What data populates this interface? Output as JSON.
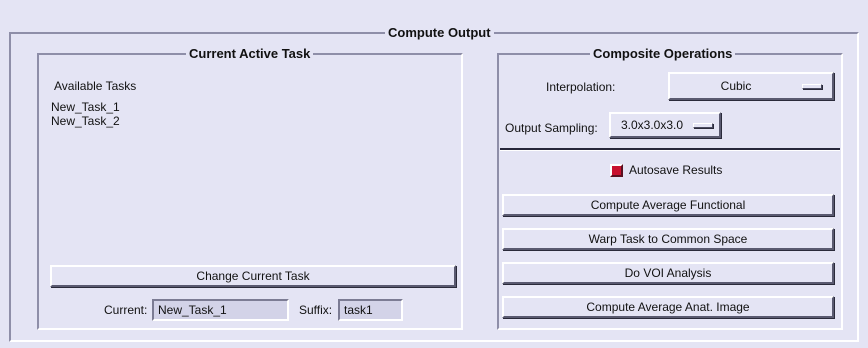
{
  "main": {
    "title": "Compute Output"
  },
  "active_task": {
    "title": "Current Active Task",
    "list_header": "Available Tasks",
    "tasks": [
      "New_Task_1",
      "New_Task_2"
    ],
    "change_button": "Change Current Task",
    "current_label": "Current:",
    "current_value": "New_Task_1",
    "suffix_label": "Suffix:",
    "suffix_value": "task1"
  },
  "composite": {
    "title": "Composite Operations",
    "interpolation_label": "Interpolation:",
    "interpolation_value": "Cubic",
    "sampling_label": "Output Sampling:",
    "sampling_value": "3.0x3.0x3.0",
    "autosave_label": "Autosave Results",
    "autosave_checked": true,
    "buttons": {
      "avg_functional": "Compute Average Functional",
      "warp_task": "Warp Task to Common Space",
      "voi": "Do VOI Analysis",
      "avg_anat": "Compute Average Anat. Image"
    }
  },
  "colors": {
    "background": "#e4e4f4",
    "checkbox": "#c8102e"
  }
}
